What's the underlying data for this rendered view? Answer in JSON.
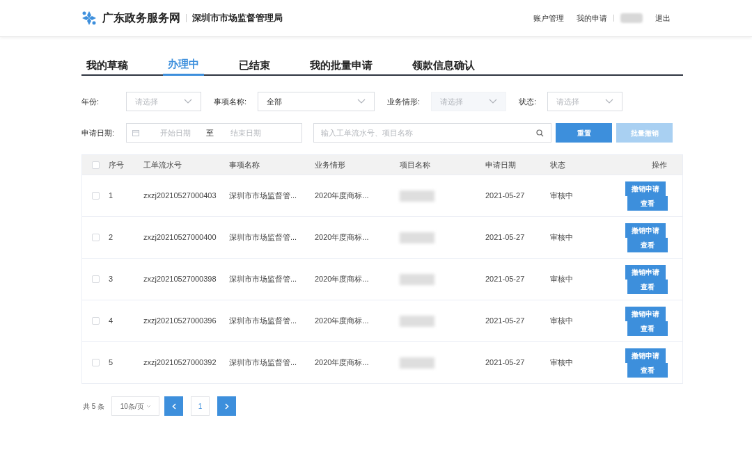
{
  "header": {
    "site_title": "广东政务服务网",
    "department": "深圳市市场监督管理局",
    "links": [
      "账户管理",
      "我的申请"
    ],
    "logout": "退出"
  },
  "tabs": [
    {
      "label": "我的草稿",
      "selected": false
    },
    {
      "label": "办理中",
      "selected": true
    },
    {
      "label": "已结束",
      "selected": false
    },
    {
      "label": "我的批量申请",
      "selected": false
    },
    {
      "label": "领款信息确认",
      "selected": false
    }
  ],
  "filters": [
    {
      "label": "年份:",
      "placeholder": "请选择",
      "disabled": false
    },
    {
      "label": "事项名称:",
      "value": "全部",
      "disabled": false
    },
    {
      "label": "业务情形:",
      "placeholder": "请选择",
      "disabled": true
    },
    {
      "label": "状态:",
      "placeholder": "请选择",
      "disabled": false
    }
  ],
  "date_filter": {
    "label": "申请日期:",
    "start_placeholder": "开始日期",
    "separator": "至",
    "end_placeholder": "结束日期"
  },
  "search": {
    "placeholder": "输入工单流水号、项目名称"
  },
  "buttons": [
    {
      "label": "重置",
      "disabled": false
    },
    {
      "label": "批量撤销",
      "disabled": true
    }
  ],
  "table": {
    "select_all_checked": false,
    "columns": [
      "序号",
      "工单流水号",
      "事项名称",
      "业务情形",
      "项目名称",
      "申请日期",
      "状态",
      "操作"
    ],
    "rows": [
      {
        "checked": false,
        "index": "1",
        "serial": "zxzj20210527000403",
        "item": "深圳市市场监督管...",
        "scenario": "2020年度商标...",
        "date": "2021-05-27",
        "status": "审核中",
        "actions": [
          "撤销申请",
          "查看"
        ]
      },
      {
        "checked": false,
        "index": "2",
        "serial": "zxzj20210527000400",
        "item": "深圳市市场监督管...",
        "scenario": "2020年度商标...",
        "date": "2021-05-27",
        "status": "审核中",
        "actions": [
          "撤销申请",
          "查看"
        ]
      },
      {
        "checked": false,
        "index": "3",
        "serial": "zxzj20210527000398",
        "item": "深圳市市场监督管...",
        "scenario": "2020年度商标...",
        "date": "2021-05-27",
        "status": "审核中",
        "actions": [
          "撤销申请",
          "查看"
        ]
      },
      {
        "checked": false,
        "index": "4",
        "serial": "zxzj20210527000396",
        "item": "深圳市市场监督管...",
        "scenario": "2020年度商标...",
        "date": "2021-05-27",
        "status": "审核中",
        "actions": [
          "撤销申请",
          "查看"
        ]
      },
      {
        "checked": false,
        "index": "5",
        "serial": "zxzj20210527000392",
        "item": "深圳市市场监督管...",
        "scenario": "2020年度商标...",
        "date": "2021-05-27",
        "status": "审核中",
        "actions": [
          "撤销申请",
          "查看"
        ]
      }
    ]
  },
  "pagination": {
    "total": "共 5 条",
    "page_size": "10条/页",
    "pages": [
      {
        "label": "1",
        "selected": true
      }
    ]
  }
}
